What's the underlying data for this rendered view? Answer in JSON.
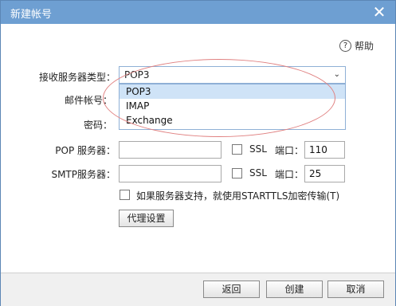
{
  "window": {
    "title": "新建帐号"
  },
  "help": {
    "label": "帮助"
  },
  "server_type": {
    "label": "接收服务器类型：",
    "value": "POP3",
    "options": [
      "POP3",
      "IMAP",
      "Exchange"
    ]
  },
  "account": {
    "label": "邮件帐号："
  },
  "password": {
    "label": "密码："
  },
  "pop": {
    "label": "POP 服务器：",
    "ssl_label": "SSL",
    "port_label": "端口：",
    "port_value": "110"
  },
  "smtp": {
    "label": "SMTP服务器：",
    "ssl_label": "SSL",
    "port_label": "端口：",
    "port_value": "25"
  },
  "starttls": {
    "label": "如果服务器支持，就使用STARTTLS加密传输(T)"
  },
  "proxy_button": "代理设置",
  "footer": {
    "back": "返回",
    "create": "创建",
    "cancel": "取消"
  },
  "colors": {
    "titlebar": "#6e9fd2",
    "annotation_ellipse": "#e08080",
    "selected_option": "#cfe3f7"
  }
}
